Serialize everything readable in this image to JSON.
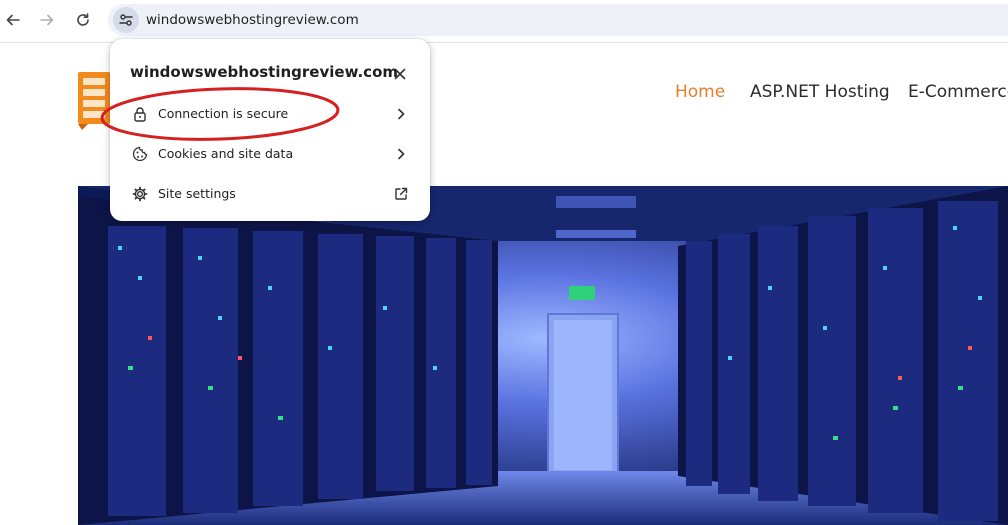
{
  "browser": {
    "url": "windowswebhostingreview.com",
    "icons": {
      "back": "back-arrow-icon",
      "forward": "forward-arrow-icon",
      "reload": "reload-icon",
      "site_info": "tune-icon"
    }
  },
  "site_info_popup": {
    "title": "windowswebhostingreview.com",
    "rows": [
      {
        "label": "Connection is secure",
        "icon": "lock-icon",
        "trailing": "chevron-right-icon"
      },
      {
        "label": "Cookies and site data",
        "icon": "cookie-icon",
        "trailing": "chevron-right-icon"
      },
      {
        "label": "Site settings",
        "icon": "gear-icon",
        "trailing": "external-link-icon"
      }
    ],
    "annotation_color": "#d42020"
  },
  "site": {
    "nav": [
      {
        "label": "Home",
        "active": true
      },
      {
        "label": "ASP.NET Hosting",
        "active": false
      },
      {
        "label": "E-Commerce",
        "active": false
      }
    ],
    "accent_color": "#e5802f",
    "hero_image": "server-room-photo"
  }
}
